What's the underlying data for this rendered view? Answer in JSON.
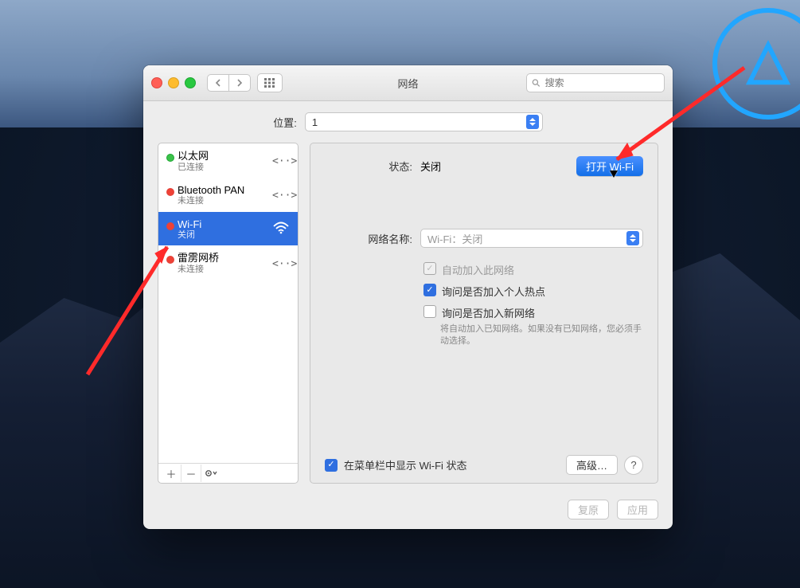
{
  "window": {
    "title": "网络",
    "search_placeholder": "搜索"
  },
  "location": {
    "label": "位置:",
    "selected": "1"
  },
  "sidebar": {
    "items": [
      {
        "name": "以太网",
        "status": "已连接",
        "dot": "green",
        "icon": "angle-brackets"
      },
      {
        "name": "Bluetooth PAN",
        "status": "未连接",
        "dot": "red",
        "icon": "angle-brackets"
      },
      {
        "name": "Wi-Fi",
        "status": "关闭",
        "dot": "red",
        "icon": "wifi"
      },
      {
        "name": "雷雳网桥",
        "status": "未连接",
        "dot": "red",
        "icon": "angle-brackets"
      }
    ],
    "selected_index": 2
  },
  "details": {
    "status_label": "状态:",
    "status_value": "关闭",
    "open_wifi_btn": "打开 Wi-Fi",
    "network_name_label": "网络名称:",
    "network_name_placeholder": "Wi-Fi：关闭",
    "auto_join_label": "自动加入此网络",
    "ask_hotspot_label": "询问是否加入个人热点",
    "ask_new_label": "询问是否加入新网络",
    "ask_new_hint": "将自动加入已知网络。如果没有已知网络，您必须手动选择。",
    "show_in_menubar_label": "在菜单栏中显示 Wi-Fi 状态",
    "advanced_label": "高级…",
    "revert_label": "复原",
    "apply_label": "应用"
  }
}
